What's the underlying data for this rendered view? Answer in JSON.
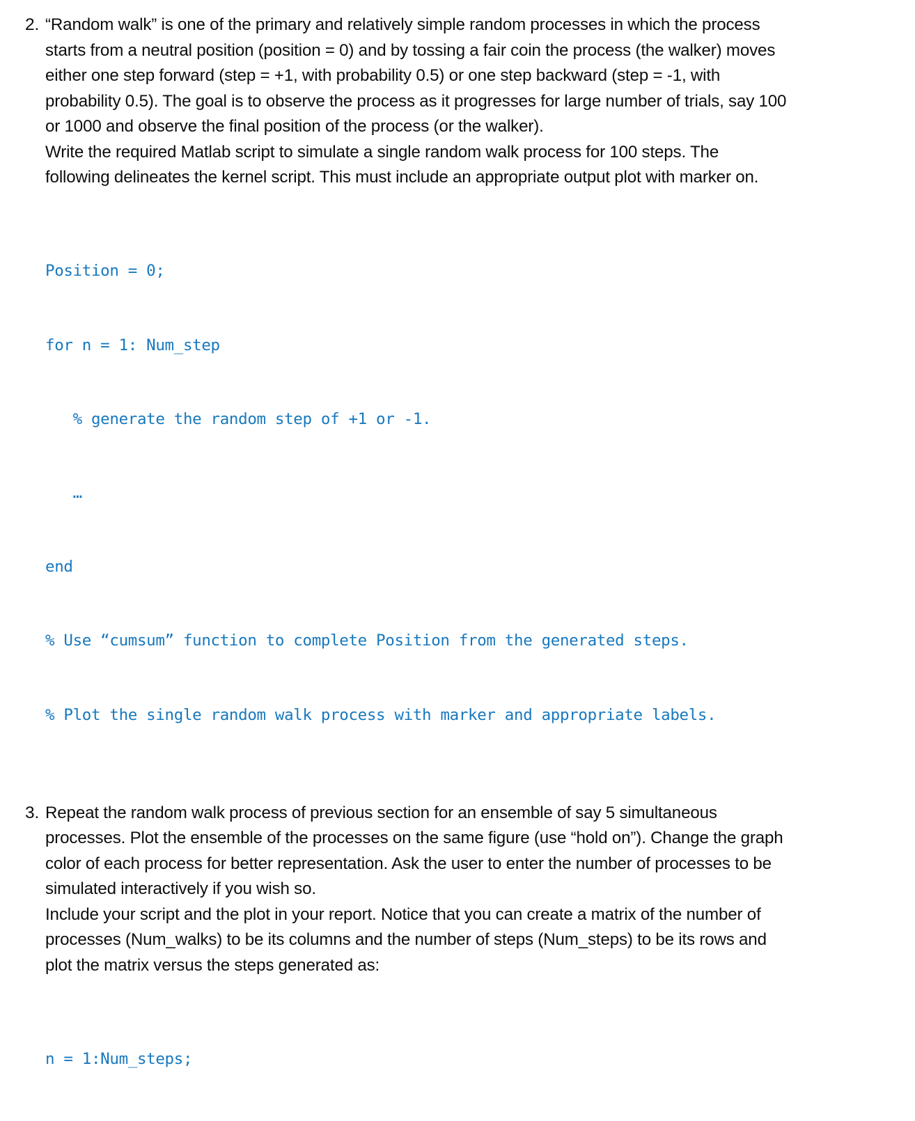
{
  "document": {
    "background_color": "#ffffff",
    "text_color": "#0d0d0d",
    "code_color": "#1878be"
  },
  "items": [
    {
      "number": "2.",
      "paragraphs": [
        "“Random walk” is one of the primary and relatively simple random processes in which the process\nstarts from a neutral position (position = 0) and by tossing a fair coin the process (the walker) moves\neither one step forward (step = +1, with probability 0.5) or one step backward (step = -1, with\nprobability 0.5). The goal is to observe the process as it progresses for large number of trials, say 100\nor 1000 and observe the final position of the process (or the walker).",
        "Write the required Matlab script to simulate a single random walk process for 100 steps. The\nfollowing delineates the kernel script. This must include an appropriate output plot with marker on."
      ],
      "code_lines": [
        "Position = 0;",
        "for n = 1: Num_step",
        "   % generate the random step of +1 or -1.",
        "   …",
        "end",
        "% Use “cumsum” function to complete Position from the generated steps.",
        "% Plot the single random walk process with marker and appropriate labels."
      ]
    },
    {
      "number": "3.",
      "paragraphs": [
        "Repeat the random walk process of previous section for an ensemble of say 5 simultaneous\nprocesses. Plot the ensemble of the processes on the same figure (use “hold on”). Change the graph\ncolor of each process for better representation. Ask the user to enter the number of processes to be\nsimulated interactively if you wish so.",
        "Include your script and the plot in your report. Notice that you can create a matrix of the number of\nprocesses (Num_walks) to be its columns and the number of steps (Num_steps) to be its rows and\nplot the matrix versus the steps generated as:"
      ],
      "code_lines": [
        "n = 1:Num_steps;"
      ]
    }
  ]
}
